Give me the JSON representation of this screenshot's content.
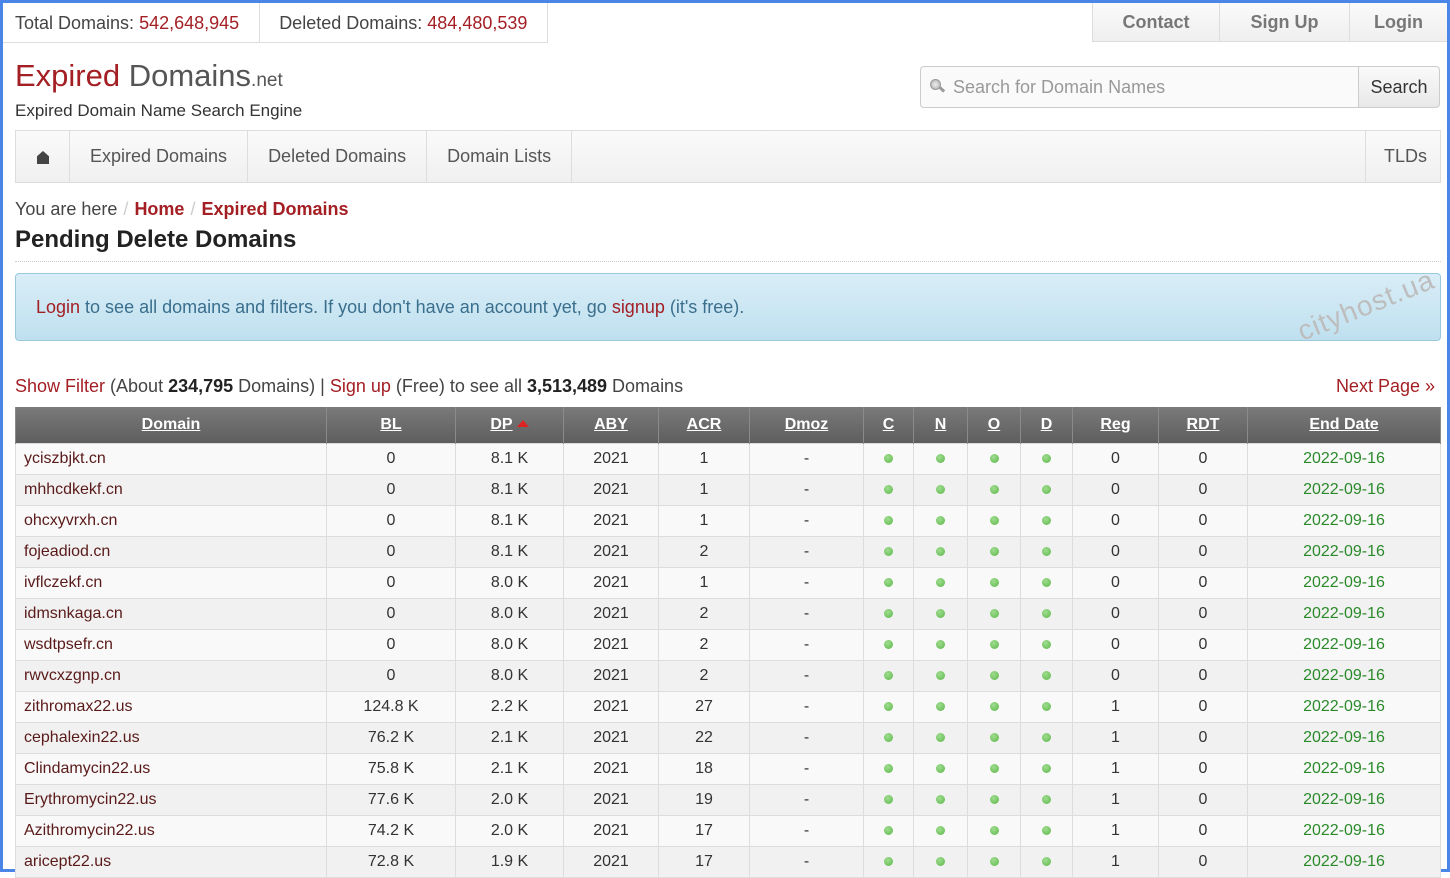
{
  "stats": {
    "total_label": "Total Domains:",
    "total_value": "542,648,945",
    "deleted_label": "Deleted Domains:",
    "deleted_value": "484,480,539"
  },
  "topnav": {
    "contact": "Contact",
    "signup": "Sign Up",
    "login": "Login"
  },
  "logo": {
    "part1": "Expired",
    "part2": " Domains",
    "part3": ".net",
    "tagline": "Expired Domain Name Search Engine"
  },
  "search": {
    "placeholder": "Search for Domain Names",
    "value": "",
    "button": "Search",
    "icon": "magnifier-icon"
  },
  "mainnav": {
    "home_icon": "home-icon",
    "items": [
      "Expired Domains",
      "Deleted Domains",
      "Domain Lists"
    ],
    "right": "TLDs"
  },
  "breadcrumb": {
    "prefix": "You are here",
    "sep": "/",
    "home": "Home",
    "current": "Expired Domains"
  },
  "page_title": "Pending Delete Domains",
  "alert": {
    "login": "Login",
    "text1": " to see all domains and filters. If you don't have an account yet, go ",
    "signup": "signup",
    "text2": " (it's free)."
  },
  "watermark": "cityhost.ua",
  "filter": {
    "show_filter": "Show Filter",
    "t1": " (About ",
    "count": "234,795",
    "t2": " Domains) | ",
    "signup": "Sign up",
    "t3": " (Free) to see all ",
    "total": "3,513,489",
    "t4": " Domains",
    "next_page": "Next Page »"
  },
  "table": {
    "sorted_column": "DP",
    "sort_direction": "ascending-indicator",
    "columns": [
      "Domain",
      "BL",
      "DP",
      "ABY",
      "ACR",
      "Dmoz",
      "C",
      "N",
      "O",
      "D",
      "Reg",
      "RDT",
      "End Date"
    ],
    "status_icon": "green-check-dot-icon",
    "rows": [
      {
        "domain": "yciszbjkt.cn",
        "bl": "0",
        "dp": "8.1 K",
        "aby": "2021",
        "acr": "1",
        "dmoz": "-",
        "c": true,
        "n": true,
        "o": true,
        "d": true,
        "reg": "0",
        "rdt": "0",
        "end": "2022-09-16"
      },
      {
        "domain": "mhhcdkekf.cn",
        "bl": "0",
        "dp": "8.1 K",
        "aby": "2021",
        "acr": "1",
        "dmoz": "-",
        "c": true,
        "n": true,
        "o": true,
        "d": true,
        "reg": "0",
        "rdt": "0",
        "end": "2022-09-16"
      },
      {
        "domain": "ohcxyvrxh.cn",
        "bl": "0",
        "dp": "8.1 K",
        "aby": "2021",
        "acr": "1",
        "dmoz": "-",
        "c": true,
        "n": true,
        "o": true,
        "d": true,
        "reg": "0",
        "rdt": "0",
        "end": "2022-09-16"
      },
      {
        "domain": "fojeadiod.cn",
        "bl": "0",
        "dp": "8.1 K",
        "aby": "2021",
        "acr": "2",
        "dmoz": "-",
        "c": true,
        "n": true,
        "o": true,
        "d": true,
        "reg": "0",
        "rdt": "0",
        "end": "2022-09-16"
      },
      {
        "domain": "ivflczekf.cn",
        "bl": "0",
        "dp": "8.0 K",
        "aby": "2021",
        "acr": "1",
        "dmoz": "-",
        "c": true,
        "n": true,
        "o": true,
        "d": true,
        "reg": "0",
        "rdt": "0",
        "end": "2022-09-16"
      },
      {
        "domain": "idmsnkaga.cn",
        "bl": "0",
        "dp": "8.0 K",
        "aby": "2021",
        "acr": "2",
        "dmoz": "-",
        "c": true,
        "n": true,
        "o": true,
        "d": true,
        "reg": "0",
        "rdt": "0",
        "end": "2022-09-16"
      },
      {
        "domain": "wsdtpsefr.cn",
        "bl": "0",
        "dp": "8.0 K",
        "aby": "2021",
        "acr": "2",
        "dmoz": "-",
        "c": true,
        "n": true,
        "o": true,
        "d": true,
        "reg": "0",
        "rdt": "0",
        "end": "2022-09-16"
      },
      {
        "domain": "rwvcxzgnp.cn",
        "bl": "0",
        "dp": "8.0 K",
        "aby": "2021",
        "acr": "2",
        "dmoz": "-",
        "c": true,
        "n": true,
        "o": true,
        "d": true,
        "reg": "0",
        "rdt": "0",
        "end": "2022-09-16"
      },
      {
        "domain": "zithromax22.us",
        "bl": "124.8 K",
        "dp": "2.2 K",
        "aby": "2021",
        "acr": "27",
        "dmoz": "-",
        "c": true,
        "n": true,
        "o": true,
        "d": true,
        "reg": "1",
        "rdt": "0",
        "end": "2022-09-16"
      },
      {
        "domain": "cephalexin22.us",
        "bl": "76.2 K",
        "dp": "2.1 K",
        "aby": "2021",
        "acr": "22",
        "dmoz": "-",
        "c": true,
        "n": true,
        "o": true,
        "d": true,
        "reg": "1",
        "rdt": "0",
        "end": "2022-09-16"
      },
      {
        "domain": "Clindamycin22.us",
        "bl": "75.8 K",
        "dp": "2.1 K",
        "aby": "2021",
        "acr": "18",
        "dmoz": "-",
        "c": true,
        "n": true,
        "o": true,
        "d": true,
        "reg": "1",
        "rdt": "0",
        "end": "2022-09-16"
      },
      {
        "domain": "Erythromycin22.us",
        "bl": "77.6 K",
        "dp": "2.0 K",
        "aby": "2021",
        "acr": "19",
        "dmoz": "-",
        "c": true,
        "n": true,
        "o": true,
        "d": true,
        "reg": "1",
        "rdt": "0",
        "end": "2022-09-16"
      },
      {
        "domain": "Azithromycin22.us",
        "bl": "74.2 K",
        "dp": "2.0 K",
        "aby": "2021",
        "acr": "17",
        "dmoz": "-",
        "c": true,
        "n": true,
        "o": true,
        "d": true,
        "reg": "1",
        "rdt": "0",
        "end": "2022-09-16"
      },
      {
        "domain": "aricept22.us",
        "bl": "72.8 K",
        "dp": "1.9 K",
        "aby": "2021",
        "acr": "17",
        "dmoz": "-",
        "c": true,
        "n": true,
        "o": true,
        "d": true,
        "reg": "1",
        "rdt": "0",
        "end": "2022-09-16"
      }
    ]
  },
  "colors": {
    "brand_red": "#a31f24",
    "date_green": "#2a8a2a",
    "header_gray": "#6a6a6a",
    "alert_blue": "#d9edf7"
  }
}
